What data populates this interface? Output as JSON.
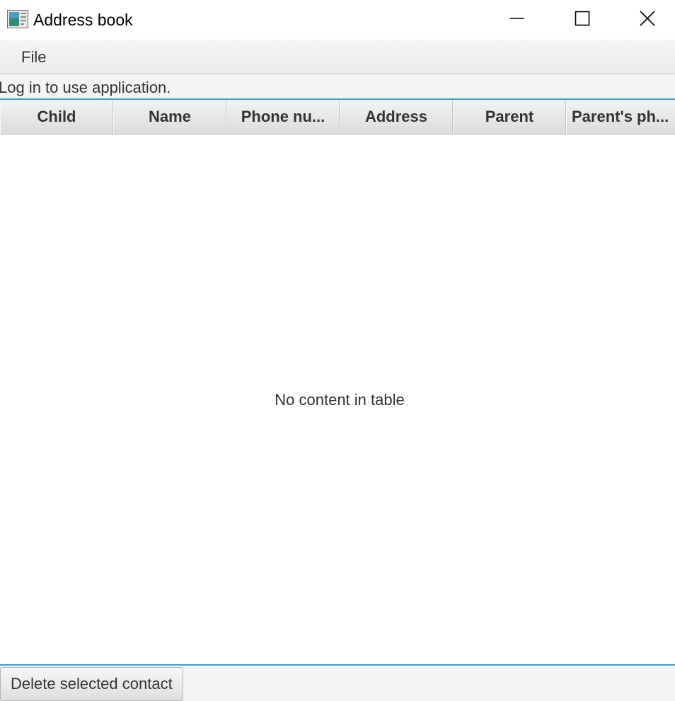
{
  "window": {
    "title": "Address book",
    "controls": {
      "minimize": "minimize-icon",
      "maximize": "maximize-icon",
      "close": "close-icon"
    }
  },
  "menubar": {
    "items": [
      {
        "label": "File"
      }
    ]
  },
  "status": {
    "text": "Log in to use application."
  },
  "table": {
    "columns": [
      {
        "label": "Child"
      },
      {
        "label": "Name"
      },
      {
        "label": "Phone nu..."
      },
      {
        "label": "Address"
      },
      {
        "label": "Parent"
      },
      {
        "label": "Parent's ph..."
      }
    ],
    "rows": [],
    "placeholder": "No content in table"
  },
  "footer": {
    "delete_label": "Delete selected contact"
  },
  "colors": {
    "accent": "#3aa0d0",
    "background": "#f4f4f4",
    "text": "#333333"
  }
}
